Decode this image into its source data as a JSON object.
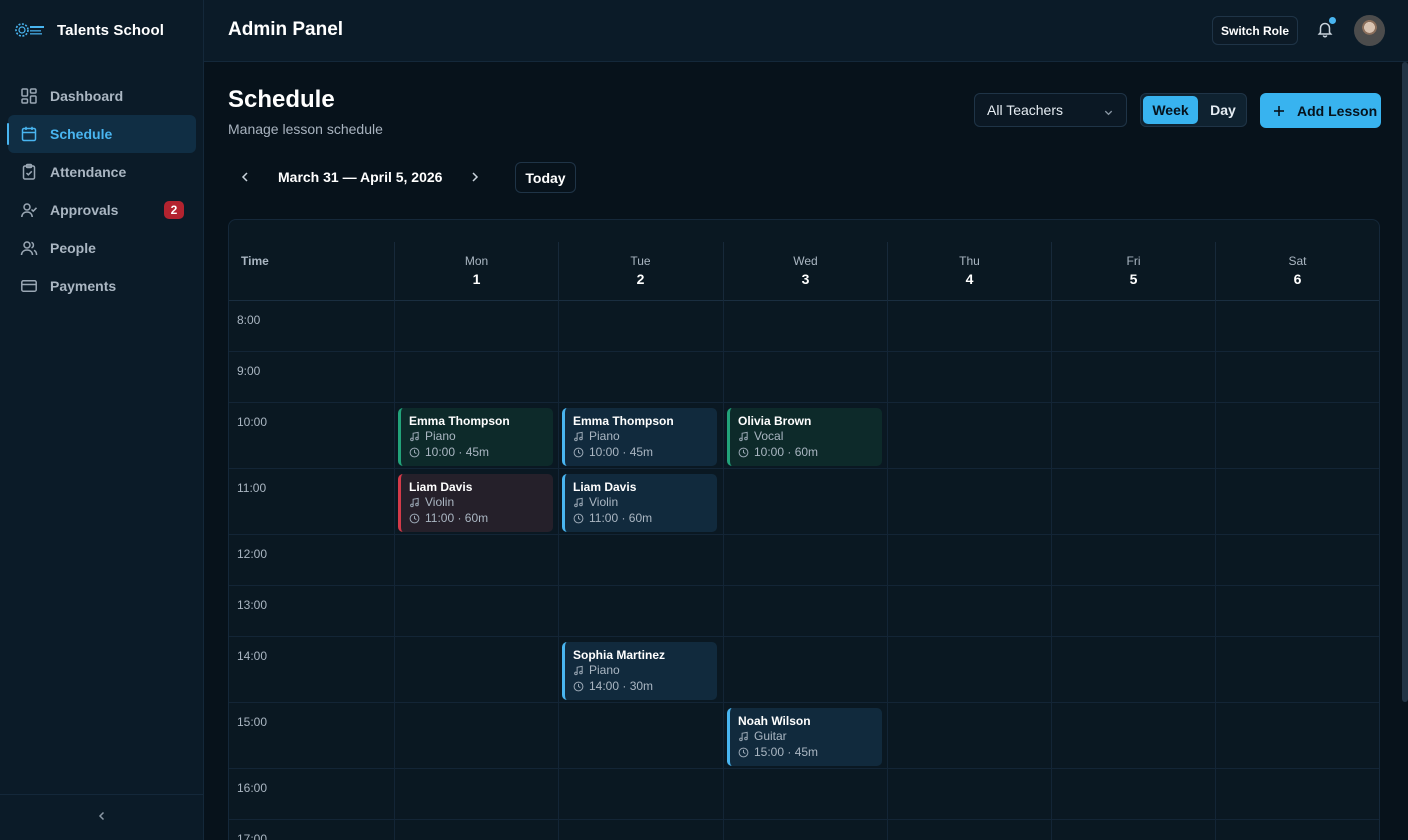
{
  "brand": {
    "name": "Talents School",
    "logo": "talents-school-logo"
  },
  "sidebar": {
    "items": [
      {
        "label": "Dashboard",
        "icon": "grid-icon"
      },
      {
        "label": "Schedule",
        "icon": "calendar-icon",
        "active": true
      },
      {
        "label": "Attendance",
        "icon": "clipboard-check-icon"
      },
      {
        "label": "Approvals",
        "icon": "user-check-icon",
        "badge": "2"
      },
      {
        "label": "People",
        "icon": "users-icon"
      },
      {
        "label": "Payments",
        "icon": "credit-card-icon"
      }
    ],
    "collapse_icon": "chevron-left-icon"
  },
  "header": {
    "title": "Admin Panel",
    "switch_role": "Switch Role",
    "has_notification": true
  },
  "page": {
    "title": "Schedule",
    "subtitle": "Manage lesson schedule",
    "teacher_filter": "All Teachers",
    "view_week": "Week",
    "view_day": "Day",
    "active_view": "Week",
    "add_lesson": "Add Lesson",
    "date_range": "March 31 — April 5, 2026",
    "today": "Today"
  },
  "calendar": {
    "time_header": "Time",
    "days": [
      {
        "name": "Mon",
        "num": "1"
      },
      {
        "name": "Tue",
        "num": "2"
      },
      {
        "name": "Wed",
        "num": "3"
      },
      {
        "name": "Thu",
        "num": "4"
      },
      {
        "name": "Fri",
        "num": "5"
      },
      {
        "name": "Sat",
        "num": "6"
      }
    ],
    "hours": [
      "8:00",
      "9:00",
      "10:00",
      "11:00",
      "12:00",
      "13:00",
      "14:00",
      "15:00",
      "16:00",
      "17:00"
    ],
    "lessons": [
      {
        "day": 0,
        "hour": 2,
        "student": "Emma Thompson",
        "instrument": "Piano",
        "time": "10:00 · 45m",
        "color": "green"
      },
      {
        "day": 1,
        "hour": 2,
        "student": "Emma Thompson",
        "instrument": "Piano",
        "time": "10:00 · 45m",
        "color": "blue"
      },
      {
        "day": 2,
        "hour": 2,
        "student": "Olivia Brown",
        "instrument": "Vocal",
        "time": "10:00 · 60m",
        "color": "green"
      },
      {
        "day": 0,
        "hour": 3,
        "student": "Liam Davis",
        "instrument": "Violin",
        "time": "11:00 · 60m",
        "color": "red"
      },
      {
        "day": 1,
        "hour": 3,
        "student": "Liam Davis",
        "instrument": "Violin",
        "time": "11:00 · 60m",
        "color": "blue"
      },
      {
        "day": 1,
        "hour": 6,
        "student": "Sophia Martinez",
        "instrument": "Piano",
        "time": "14:00 · 30m",
        "color": "blue"
      },
      {
        "day": 2,
        "hour": 7,
        "student": "Noah Wilson",
        "instrument": "Guitar",
        "time": "15:00 · 45m",
        "color": "blue"
      }
    ]
  },
  "colors": {
    "accent": "#38b3ef",
    "green": "#22a37a",
    "red": "#d33a49",
    "badge": "#b3232f"
  }
}
